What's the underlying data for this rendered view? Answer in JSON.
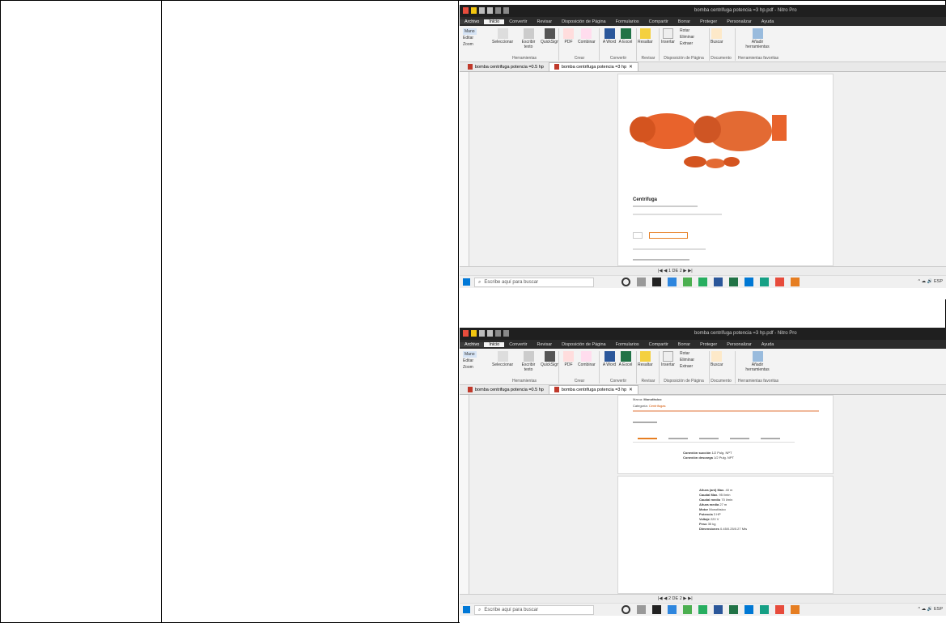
{
  "screens": [
    {
      "window_title": "bomba centrifuga potencia =3 hp.pdf - Nitro Pro",
      "menu": [
        "Archivo",
        "Inicio",
        "Convertir",
        "Revisar",
        "Disposición de Página",
        "Formularios",
        "Compartir",
        "Borrar",
        "Proteger",
        "Personalizar",
        "Ayuda"
      ],
      "ribbon": {
        "mode": [
          "Mano",
          "Editar",
          "Zoom"
        ],
        "buttons": [
          "Seleccionar",
          "Escribir texto",
          "QuickSign",
          "PDF",
          "Combinar",
          "A Word",
          "A Excel",
          "Resaltar",
          "Insertar",
          "Rotar",
          "Eliminar",
          "Extraer",
          "Buscar",
          "Añadir herramientas"
        ],
        "groups": [
          "Herramientas",
          "Crear",
          "Convertir",
          "Revisar",
          "Disposición de Página",
          "Documento",
          "Herramientas favoritas"
        ]
      },
      "tabs": [
        "bomba centrifuga potencia =0.5 hp",
        "bomba centrifuga potencia =3 hp"
      ],
      "page_indicator": "1 DE 2"
    },
    {
      "window_title": "bomba centrifuga potencia =3 hp.pdf - Nitro Pro",
      "menu": [
        "Archivo",
        "Inicio",
        "Convertir",
        "Revisar",
        "Disposición de Página",
        "Formularios",
        "Compartir",
        "Borrar",
        "Proteger",
        "Personalizar",
        "Ayuda"
      ],
      "ribbon": {
        "mode": [
          "Mano",
          "Editar",
          "Zoom"
        ],
        "buttons": [
          "Seleccionar",
          "Escribir texto",
          "QuickSign",
          "PDF",
          "Combinar",
          "A Word",
          "A Excel",
          "Resaltar",
          "Insertar",
          "Rotar",
          "Eliminar",
          "Extraer",
          "Buscar",
          "Añadir herramientas"
        ],
        "groups": [
          "Herramientas",
          "Crear",
          "Convertir",
          "Revisar",
          "Disposición de Página",
          "Documento",
          "Herramientas favoritas"
        ]
      },
      "tabs": [
        "bomba centrifuga potencia =0.5 hp",
        "bomba centrifuga potencia =3 hp"
      ],
      "page_indicator": "2 DE 2"
    }
  ],
  "page1": {
    "product_title": "Centrifuga"
  },
  "page2": {
    "marca_label": "Marca:",
    "marca": "Monofásico",
    "categoria_label": "Categoría:",
    "categoria": "Centrífugas",
    "specs": [
      [
        "Conexión succión",
        "1/2 Pulg. NPT"
      ],
      [
        "Conexión descarga",
        "1/2 Pulg. NPT"
      ]
    ],
    "specs2": [
      [
        "Altura (ant) Max.",
        "40 m"
      ],
      [
        "Caudal Max.",
        "95 l/min"
      ],
      [
        "Caudal medio",
        "70 l/min"
      ],
      [
        "Altura media",
        "27 m"
      ],
      [
        "Motor",
        "Monofásico"
      ],
      [
        "Potencia",
        "3 HP"
      ],
      [
        "Voltaje",
        "220 V"
      ],
      [
        "Peso",
        "35 kg"
      ],
      [
        "Dimensiones",
        "0.45/0.25/0.27 Mts"
      ]
    ]
  },
  "taskbar": {
    "search_placeholder": "Escribe aquí para buscar",
    "lang": "ESP"
  }
}
